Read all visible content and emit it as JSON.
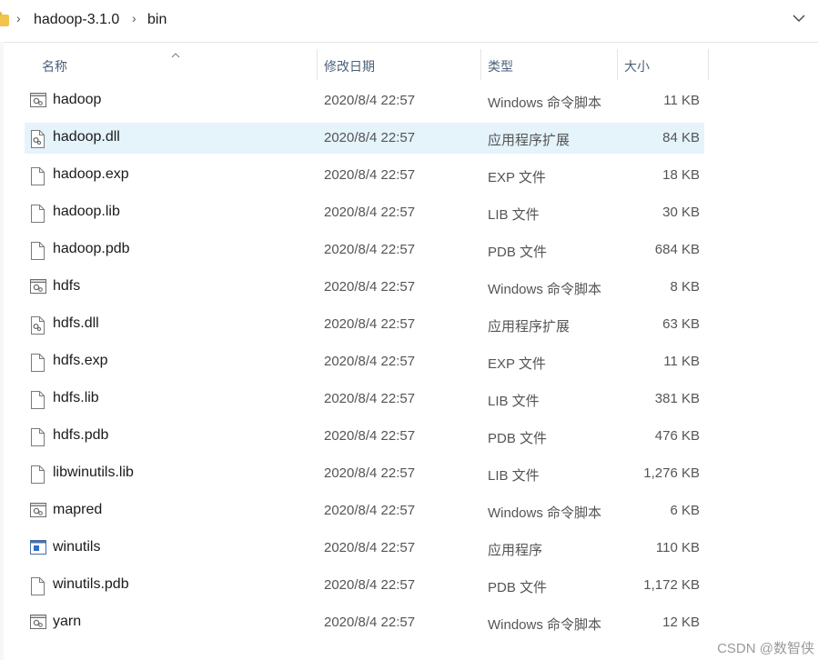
{
  "breadcrumb": {
    "items": [
      "hadoop-3.1.0",
      "bin"
    ]
  },
  "columns": {
    "name": "名称",
    "date": "修改日期",
    "type": "类型",
    "size": "大小"
  },
  "files": [
    {
      "name": "hadoop",
      "date": "2020/8/4 22:57",
      "type": "Windows 命令脚本",
      "size": "11 KB",
      "icon": "cmd-script-icon",
      "selected": false
    },
    {
      "name": "hadoop.dll",
      "date": "2020/8/4 22:57",
      "type": "应用程序扩展",
      "size": "84 KB",
      "icon": "dll-icon",
      "selected": true
    },
    {
      "name": "hadoop.exp",
      "date": "2020/8/4 22:57",
      "type": "EXP 文件",
      "size": "18 KB",
      "icon": "file-icon",
      "selected": false
    },
    {
      "name": "hadoop.lib",
      "date": "2020/8/4 22:57",
      "type": "LIB 文件",
      "size": "30 KB",
      "icon": "file-icon",
      "selected": false
    },
    {
      "name": "hadoop.pdb",
      "date": "2020/8/4 22:57",
      "type": "PDB 文件",
      "size": "684 KB",
      "icon": "file-icon",
      "selected": false
    },
    {
      "name": "hdfs",
      "date": "2020/8/4 22:57",
      "type": "Windows 命令脚本",
      "size": "8 KB",
      "icon": "cmd-script-icon",
      "selected": false
    },
    {
      "name": "hdfs.dll",
      "date": "2020/8/4 22:57",
      "type": "应用程序扩展",
      "size": "63 KB",
      "icon": "dll-icon",
      "selected": false
    },
    {
      "name": "hdfs.exp",
      "date": "2020/8/4 22:57",
      "type": "EXP 文件",
      "size": "11 KB",
      "icon": "file-icon",
      "selected": false
    },
    {
      "name": "hdfs.lib",
      "date": "2020/8/4 22:57",
      "type": "LIB 文件",
      "size": "381 KB",
      "icon": "file-icon",
      "selected": false
    },
    {
      "name": "hdfs.pdb",
      "date": "2020/8/4 22:57",
      "type": "PDB 文件",
      "size": "476 KB",
      "icon": "file-icon",
      "selected": false
    },
    {
      "name": "libwinutils.lib",
      "date": "2020/8/4 22:57",
      "type": "LIB 文件",
      "size": "1,276 KB",
      "icon": "file-icon",
      "selected": false
    },
    {
      "name": "mapred",
      "date": "2020/8/4 22:57",
      "type": "Windows 命令脚本",
      "size": "6 KB",
      "icon": "cmd-script-icon",
      "selected": false
    },
    {
      "name": "winutils",
      "date": "2020/8/4 22:57",
      "type": "应用程序",
      "size": "110 KB",
      "icon": "exe-icon",
      "selected": false
    },
    {
      "name": "winutils.pdb",
      "date": "2020/8/4 22:57",
      "type": "PDB 文件",
      "size": "1,172 KB",
      "icon": "file-icon",
      "selected": false
    },
    {
      "name": "yarn",
      "date": "2020/8/4 22:57",
      "type": "Windows 命令脚本",
      "size": "12 KB",
      "icon": "cmd-script-icon",
      "selected": false
    }
  ],
  "watermark": "CSDN @数智侠",
  "colors": {
    "selected_row": "#e5f3fb",
    "header_text": "#4c607a",
    "folder": "#f3c44d"
  }
}
